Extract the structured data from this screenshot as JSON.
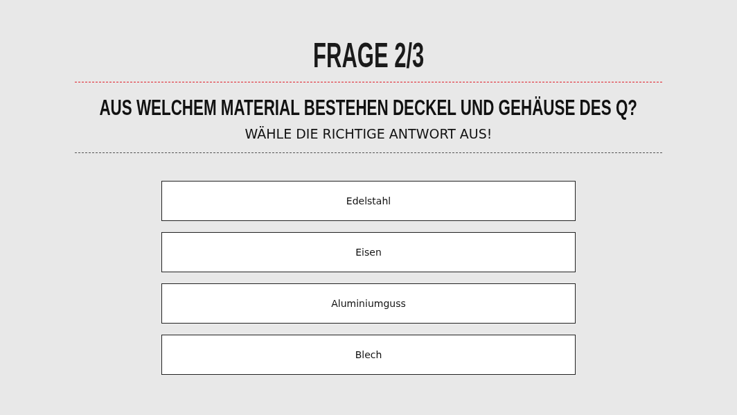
{
  "title": "FRAGE 2/3",
  "question": "AUS WELCHEM MATERIAL BESTEHEN DECKEL UND GEHÄUSE DES Q?",
  "instruction": "WÄHLE DIE RICHTIGE ANTWORT AUS!",
  "answers": [
    {
      "label": "Edelstahl"
    },
    {
      "label": "Eisen"
    },
    {
      "label": "Aluminiumguss"
    },
    {
      "label": "Blech"
    }
  ]
}
